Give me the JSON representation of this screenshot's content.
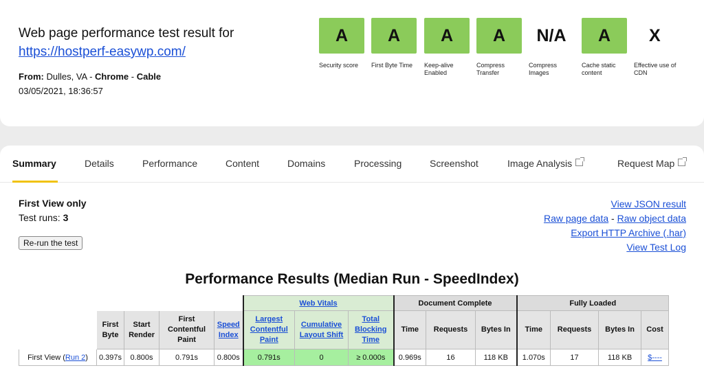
{
  "header": {
    "title": "Web page performance test result for",
    "url": "https://hostperf-easywp.com/",
    "from_label": "From:",
    "location": "Dulles, VA",
    "browser": "Chrome",
    "connection": "Cable",
    "separator": " - ",
    "date": "03/05/2021, 18:36:57"
  },
  "grades": [
    {
      "value": "A",
      "label": "Security score",
      "status": "green"
    },
    {
      "value": "A",
      "label": "First Byte Time",
      "status": "green"
    },
    {
      "value": "A",
      "label": "Keep-alive Enabled",
      "status": "green"
    },
    {
      "value": "A",
      "label": "Compress Transfer",
      "status": "green"
    },
    {
      "value": "N/A",
      "label": "Compress Images",
      "status": "none"
    },
    {
      "value": "A",
      "label": "Cache static content",
      "status": "green"
    },
    {
      "value": "X",
      "label": "Effective use of CDN",
      "status": "none"
    }
  ],
  "tabs": [
    {
      "label": "Summary",
      "active": true
    },
    {
      "label": "Details"
    },
    {
      "label": "Performance"
    },
    {
      "label": "Content"
    },
    {
      "label": "Domains"
    },
    {
      "label": "Processing"
    },
    {
      "label": "Screenshot"
    },
    {
      "label": "Image Analysis",
      "external": true
    },
    {
      "label": "Request Map",
      "external": true
    }
  ],
  "summary": {
    "view": "First View only",
    "runs_label": "Test runs:",
    "runs_value": "3",
    "rerun_button": "Re-run the test"
  },
  "links": {
    "json": "View JSON result",
    "raw_page": "Raw page data",
    "dash": " - ",
    "raw_object": "Raw object data",
    "har": "Export HTTP Archive (.har)",
    "log": "View Test Log"
  },
  "results": {
    "title": "Performance Results (Median Run - SpeedIndex)",
    "groups": {
      "web_vitals": "Web Vitals",
      "document_complete": "Document Complete",
      "fully_loaded": "Fully Loaded"
    },
    "columns": {
      "first_byte": "First Byte",
      "start_render": "Start Render",
      "fcp": "First Contentful Paint",
      "speed_index": "Speed Index",
      "lcp": "Largest Contentful Paint",
      "cls": "Cumulative Layout Shift",
      "tbt": "Total Blocking Time",
      "time": "Time",
      "requests": "Requests",
      "bytes_in": "Bytes In",
      "cost": "Cost"
    },
    "row": {
      "label": "First View (",
      "run_link": "Run 2",
      "label_end": ")",
      "first_byte": "0.397s",
      "start_render": "0.800s",
      "fcp": "0.791s",
      "speed_index": "0.800s",
      "lcp": "0.791s",
      "cls": "0",
      "tbt": "≥ 0.000s",
      "doc_time": "0.969s",
      "doc_requests": "16",
      "doc_bytes": "118 KB",
      "full_time": "1.070s",
      "full_requests": "17",
      "full_bytes": "118 KB",
      "cost": "$----"
    }
  },
  "colors": {
    "grade_green": "#8bcb5a",
    "vital_good": "#a6ef9f",
    "link": "#1a4fd6",
    "tab_accent": "#f0c20b"
  }
}
